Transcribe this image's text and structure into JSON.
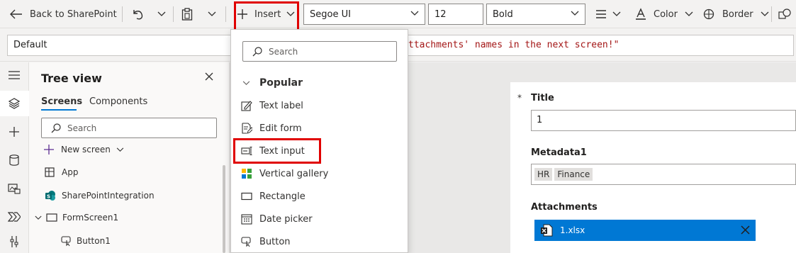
{
  "toolbar": {
    "back_label": "Back to SharePoint",
    "insert_label": "Insert",
    "font_family": "Segoe UI",
    "font_size": "12",
    "font_weight": "Bold",
    "color_label": "Color",
    "border_label": "Border"
  },
  "formula_bar": {
    "property": "Default",
    "formula": "ttachments' names in the next screen!\""
  },
  "tree_view": {
    "title": "Tree view",
    "tabs": [
      "Screens",
      "Components"
    ],
    "search_placeholder": "Search",
    "new_screen_label": "New screen",
    "items": [
      "App",
      "SharePointIntegration",
      "FormScreen1",
      "Button1"
    ]
  },
  "insert_menu": {
    "search_placeholder": "Search",
    "section": "Popular",
    "items": [
      "Text label",
      "Edit form",
      "Text input",
      "Vertical gallery",
      "Rectangle",
      "Date picker",
      "Button"
    ]
  },
  "form": {
    "required_mark": "*",
    "title_label": "Title",
    "title_value": "1",
    "metadata_label": "Metadata1",
    "metadata_tags": [
      "HR",
      "Finance"
    ],
    "attachments_label": "Attachments",
    "attachment_file": "1.xlsx"
  },
  "colors": {
    "accent": "#0078d4",
    "highlight": "#e00000",
    "formula_text": "#a31515"
  }
}
